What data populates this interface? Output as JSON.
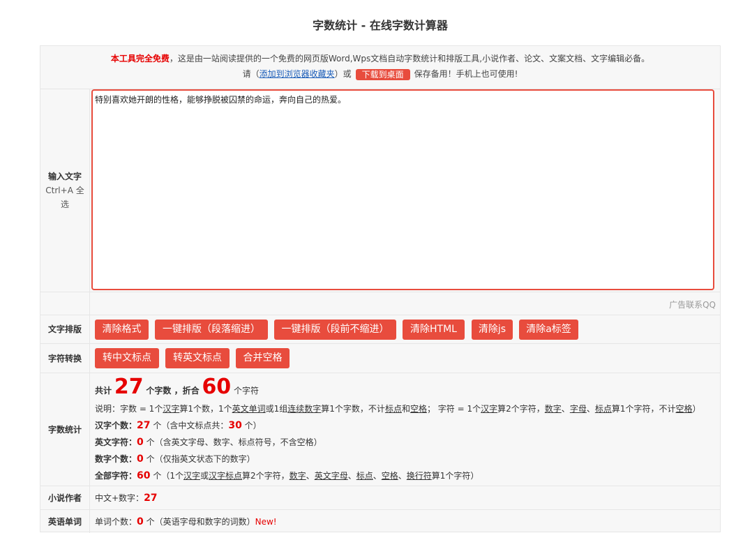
{
  "page_title": "字数统计 - 在线字数计算器",
  "intro": {
    "free_label": "本工具完全免费",
    "desc": "，这是由一站阅读提供的一个免费的网页版Word,Wps文档自动字数统计和排版工具,小说作者、论文、文案文档、文字编辑必备。",
    "please": "请（",
    "fav_link": "添加到浏览器收藏夹",
    "or": "）或",
    "download_btn": "下载到桌面",
    "save_tip": "保存备用！手机上也可使用!"
  },
  "input": {
    "label_main": "输入文字",
    "label_hint": "Ctrl+A 全选",
    "text": "特别喜欢她开朗的性格，能够挣脱被囚禁的命运，奔向自己的热爱。"
  },
  "ad_text": "广告联系QQ",
  "format": {
    "label": "文字排版",
    "buttons": [
      "清除格式",
      "一键排版（段落缩进）",
      "一键排版（段前不缩进）",
      "清除HTML",
      "清除js",
      "清除a标签"
    ]
  },
  "convert": {
    "label": "字符转换",
    "buttons": [
      "转中文标点",
      "转英文标点",
      "合并空格"
    ]
  },
  "stats": {
    "label": "字数统计",
    "total_prefix": "共计",
    "word_count": "27",
    "word_unit": "个字数 ，折合",
    "char_count": "60",
    "char_unit": "个字符",
    "explain": {
      "a": "说明：字数 = 1个",
      "hanzi": "汉字",
      "b": "算1个数，1个",
      "en_word": "英文单词",
      "c": "或1组",
      "digits": "连续数字",
      "d": "算1个字数，不计",
      "punct": "标点",
      "e": "和",
      "space": "空格",
      "f": "；  字符 = 1个",
      "hanzi2": "汉字",
      "g": "算2个字符，",
      "digit": "数字",
      "h": "、",
      "letter": "字母",
      "i": "、",
      "punct2": "标点",
      "j": "算1个字符，不计",
      "space2": "空格",
      "k": "）"
    },
    "hanzi_label": "汉字个数：",
    "hanzi_value": "27",
    "hanzi_note_a": "个（含中文标点共：",
    "hanzi_punct_value": "30",
    "hanzi_note_b": "个）",
    "en_label": "英文字符：",
    "en_value": "0",
    "en_note": "个（含英文字母、数字、标点符号，不含空格）",
    "num_label": "数字个数：",
    "num_value": "0",
    "num_note": "个（仅指英文状态下的数字）",
    "all_label": "全部字符：",
    "all_value": "60",
    "all": {
      "a": "个（1个",
      "hanzi": "汉字",
      "b": "或",
      "cn_punct": "汉字标点",
      "c": "算2个字符，",
      "digit": "数字",
      "d": "、",
      "en_letter": "英文字母",
      "e": "、",
      "punct": "标点",
      "f": "、",
      "space": "空格",
      "g": "、",
      "newline": "换行符",
      "h": "算1个字符）"
    }
  },
  "novel": {
    "label": "小说作者",
    "text": "中文+数字：",
    "value": "27"
  },
  "english": {
    "label": "英语单词",
    "text": "单词个数：",
    "value": "0",
    "note": "个（英语字母和数字的词数）",
    "new_badge": "New!"
  },
  "colors": {
    "accent": "#e84c3d",
    "highlight": "#e60000",
    "link": "#1a5cb8",
    "panel_bg": "#f7f7f7",
    "border": "#e6e6e6"
  }
}
